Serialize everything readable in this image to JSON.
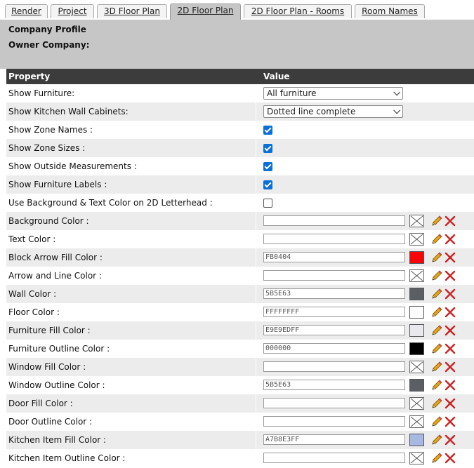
{
  "tabs": [
    {
      "label": "Render",
      "active": false
    },
    {
      "label": "Project",
      "active": false
    },
    {
      "label": "3D Floor Plan",
      "active": false
    },
    {
      "label": "2D Floor Plan",
      "active": true
    },
    {
      "label": "2D Floor Plan - Rooms",
      "active": false
    },
    {
      "label": "Room Names",
      "active": false
    }
  ],
  "company": {
    "profile_label": "Company Profile",
    "owner_label": "Owner Company:"
  },
  "grid": {
    "header_property": "Property",
    "header_value": "Value",
    "rows": [
      {
        "label": "Show Furniture:",
        "type": "select",
        "value": "All furniture"
      },
      {
        "label": "Show Kitchen Wall Cabinets:",
        "type": "select",
        "value": "Dotted line complete"
      },
      {
        "label": "Show Zone Names :",
        "type": "checkbox",
        "checked": true
      },
      {
        "label": "Show Zone Sizes :",
        "type": "checkbox",
        "checked": true
      },
      {
        "label": "Show Outside Measurements :",
        "type": "checkbox",
        "checked": true
      },
      {
        "label": "Show Furniture Labels :",
        "type": "checkbox",
        "checked": true
      },
      {
        "label": "Use Background & Text Color on 2D Letterhead :",
        "type": "checkbox",
        "checked": false
      },
      {
        "label": "Background Color :",
        "type": "color",
        "value": "",
        "swatch": ""
      },
      {
        "label": "Text Color :",
        "type": "color",
        "value": "",
        "swatch": ""
      },
      {
        "label": "Block Arrow Fill Color :",
        "type": "color",
        "value": "FB0404",
        "swatch": "#FB0404"
      },
      {
        "label": "Arrow and Line Color :",
        "type": "color",
        "value": "",
        "swatch": ""
      },
      {
        "label": "Wall Color :",
        "type": "color",
        "value": "5B5E63",
        "swatch": "#5B5E63"
      },
      {
        "label": "Floor Color :",
        "type": "color",
        "value": "FFFFFFFF",
        "swatch": "#FFFFFF"
      },
      {
        "label": "Furniture Fill Color :",
        "type": "color",
        "value": "E9E9EDFF",
        "swatch": "#E9E9ED"
      },
      {
        "label": "Furniture Outline Color :",
        "type": "color",
        "value": "000000",
        "swatch": "#000000"
      },
      {
        "label": "Window Fill Color :",
        "type": "color",
        "value": "",
        "swatch": ""
      },
      {
        "label": "Window Outline Color :",
        "type": "color",
        "value": "5B5E63",
        "swatch": "#5B5E63"
      },
      {
        "label": "Door Fill Color :",
        "type": "color",
        "value": "",
        "swatch": ""
      },
      {
        "label": "Door Outline Color :",
        "type": "color",
        "value": "",
        "swatch": ""
      },
      {
        "label": "Kitchen Item Fill Color :",
        "type": "color",
        "value": "A7B8E3FF",
        "swatch": "#A7B8E3"
      },
      {
        "label": "Kitchen Item Outline Color :",
        "type": "color",
        "value": "",
        "swatch": ""
      }
    ]
  },
  "icons": {
    "pencil": "pencil-icon",
    "delete": "delete-x-icon",
    "no_color": "no-color-icon"
  },
  "colors": {
    "header_bg": "#3C3C3C",
    "panel_bg": "#C6C6C6",
    "alt_row": "#ECECEC",
    "checkbox": "#0A6FD6",
    "delete": "#CC2222"
  }
}
